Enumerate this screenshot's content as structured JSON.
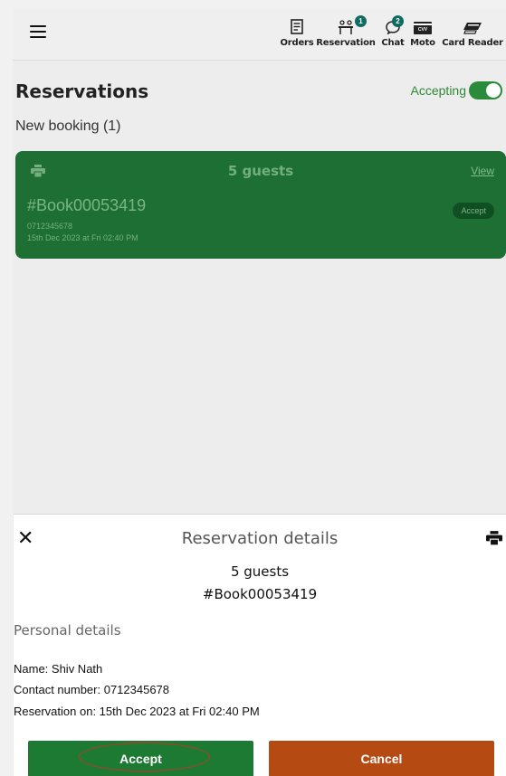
{
  "topbar": {
    "nav": [
      {
        "label": "Orders",
        "icon": "orders-icon"
      },
      {
        "label": "Reservation",
        "icon": "reservation-icon",
        "badge": "1"
      },
      {
        "label": "Chat",
        "icon": "chat-icon",
        "badge": "2"
      },
      {
        "label": "Moto",
        "icon": "cvv-card-icon",
        "icon_text": "CVV"
      },
      {
        "label": "Card Reader",
        "icon": "card-reader-icon"
      }
    ]
  },
  "page": {
    "title": "Reservations",
    "accepting_label": "Accepting",
    "accepting_on": true,
    "new_booking": "New booking (1)"
  },
  "booking_card": {
    "guests": "5 guests",
    "view_label": "View",
    "booking_number": "#Book00053419",
    "phone": "0712345678",
    "datetime": "15th Dec 2023 at Fri 02:40 PM",
    "accept_label": "Accept"
  },
  "details": {
    "title": "Reservation details",
    "guests": "5 guests",
    "booking_number": "#Book00053419",
    "section_title": "Personal details",
    "name": "Name: Shiv  Nath",
    "contact": "Contact number: 0712345678",
    "reservation_on": "Reservation on: 15th Dec 2023 at Fri 02:40 PM",
    "accept_label": "Accept",
    "cancel_label": "Cancel"
  },
  "colors": {
    "card_green": "#1d6f33",
    "accept_green": "#1d7a32",
    "cancel_orange": "#b64a13",
    "badge_teal": "#0d6b5f",
    "highlight_red": "#c8312a"
  }
}
